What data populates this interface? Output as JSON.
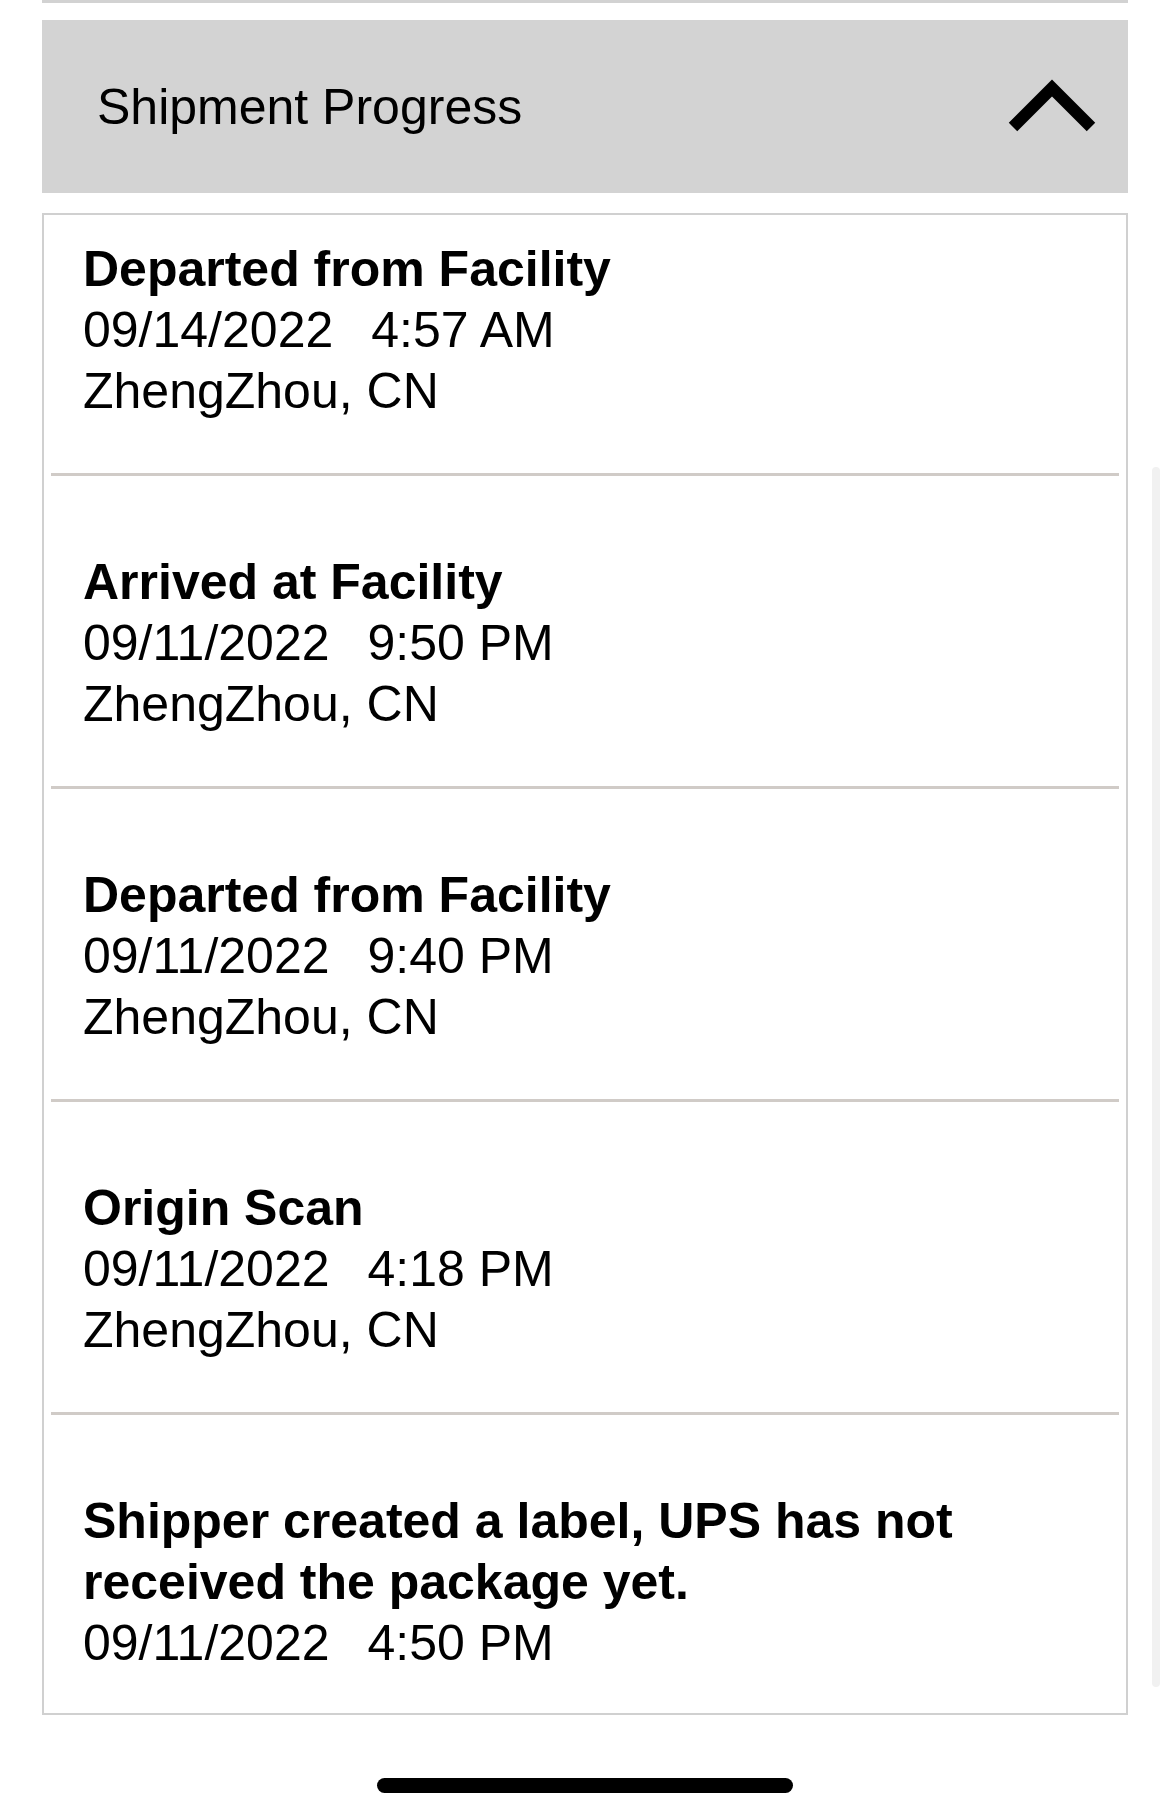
{
  "section": {
    "title": "Shipment Progress",
    "expanded": true
  },
  "events": [
    {
      "status": "Departed from Facility",
      "date": "09/14/2022",
      "time": "4:57 AM",
      "location": "ZhengZhou, CN"
    },
    {
      "status": "Arrived at Facility",
      "date": "09/11/2022",
      "time": "9:50 PM",
      "location": "ZhengZhou, CN"
    },
    {
      "status": "Departed from Facility",
      "date": "09/11/2022",
      "time": "9:40 PM",
      "location": "ZhengZhou, CN"
    },
    {
      "status": "Origin Scan",
      "date": "09/11/2022",
      "time": "4:18 PM",
      "location": "ZhengZhou, CN"
    },
    {
      "status": "Shipper created a label, UPS has not received the package yet.",
      "date": "09/11/2022",
      "time": "4:50 PM"
    }
  ]
}
